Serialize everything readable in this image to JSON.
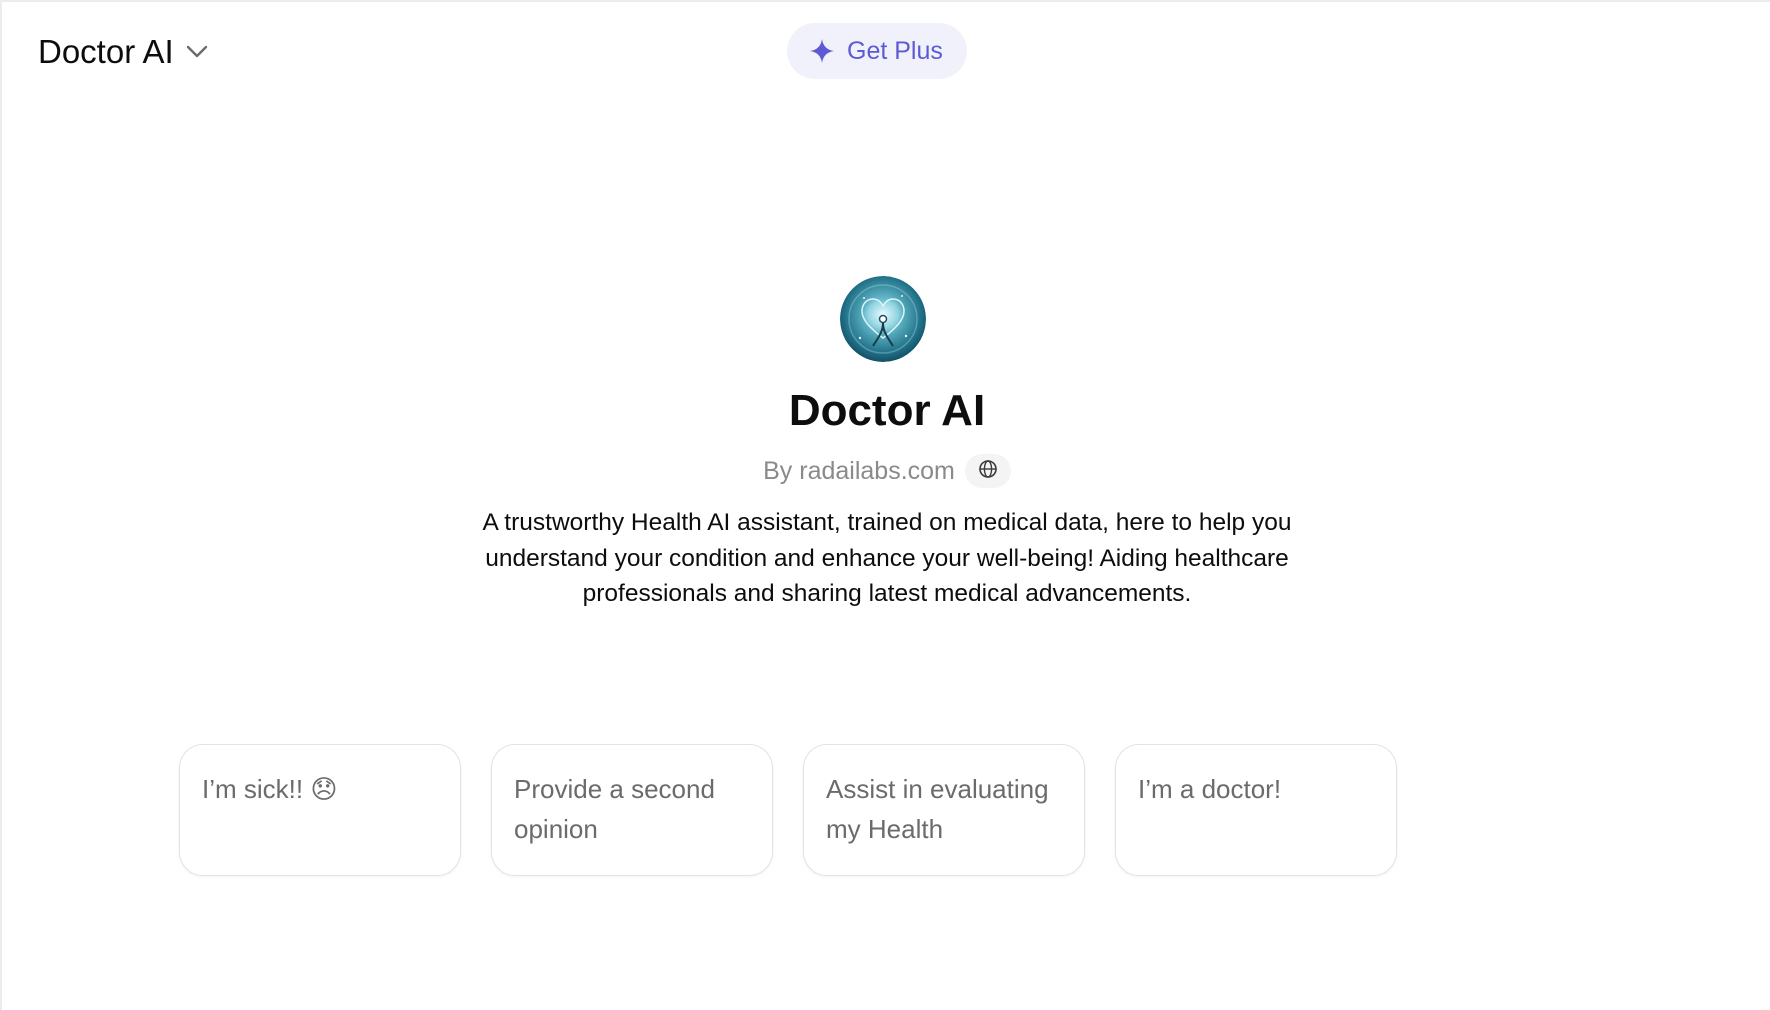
{
  "header": {
    "model_name": "Doctor AI",
    "model_icon": "chevron-down-icon",
    "upgrade_label": "Get Plus",
    "upgrade_icon": "sparkle-icon",
    "accent_color": "#5d5bd4"
  },
  "gpt": {
    "name": "Doctor AI",
    "author": "By radailabs.com",
    "author_icon": "globe-icon",
    "description": "A trustworthy Health AI assistant, trained on medical data, here to help you understand your condition and enhance your well-being! Aiding healthcare professionals and sharing latest medical advancements."
  },
  "starters": [
    {
      "text": "I’m sick!! 😞"
    },
    {
      "text": "Provide a second opinion"
    },
    {
      "text": "Assist in evaluating my Health"
    },
    {
      "text": "I’m a doctor!"
    }
  ]
}
